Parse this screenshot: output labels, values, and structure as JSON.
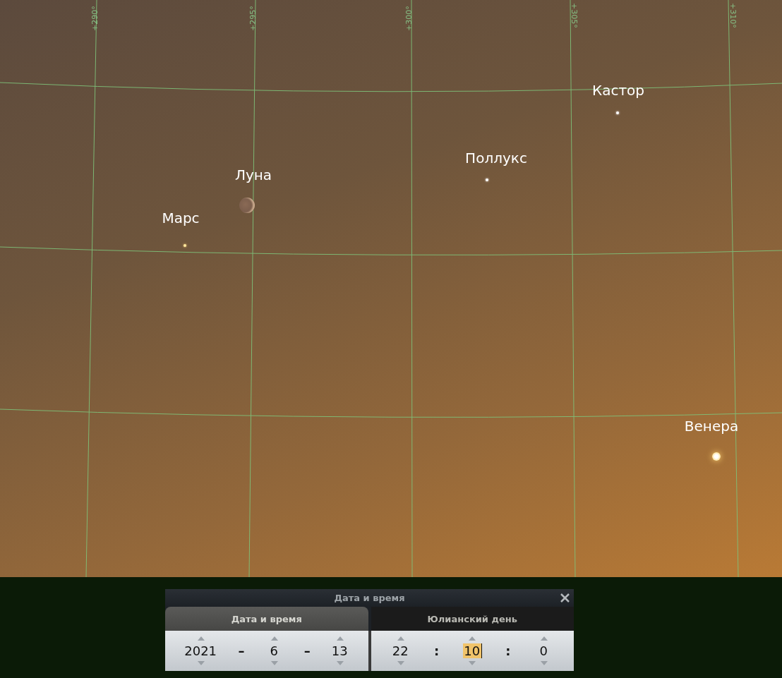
{
  "sky": {
    "grid_labels": [
      "+290°",
      "+295°",
      "+300°",
      "+305°",
      "+310°"
    ],
    "objects": [
      {
        "name": "Кастор",
        "kind": "star"
      },
      {
        "name": "Поллукс",
        "kind": "star"
      },
      {
        "name": "Луна",
        "kind": "moon"
      },
      {
        "name": "Марс",
        "kind": "planet"
      },
      {
        "name": "Венера",
        "kind": "bright_planet"
      }
    ]
  },
  "dialog": {
    "title": "Дата и время",
    "tabs": [
      {
        "label": "Дата и время",
        "selected": true
      },
      {
        "label": "Юлианский день",
        "selected": false
      }
    ],
    "panels": [
      {
        "fields": [
          {
            "value": "2021",
            "selected": false
          },
          {
            "value": "6",
            "selected": false
          },
          {
            "value": "13",
            "selected": false
          }
        ],
        "separators": [
          "–",
          "–"
        ]
      },
      {
        "fields": [
          {
            "value": "22",
            "selected": false
          },
          {
            "value": "10",
            "selected": true
          },
          {
            "value": "0",
            "selected": false
          }
        ],
        "separators": [
          ":",
          ":"
        ]
      }
    ]
  }
}
